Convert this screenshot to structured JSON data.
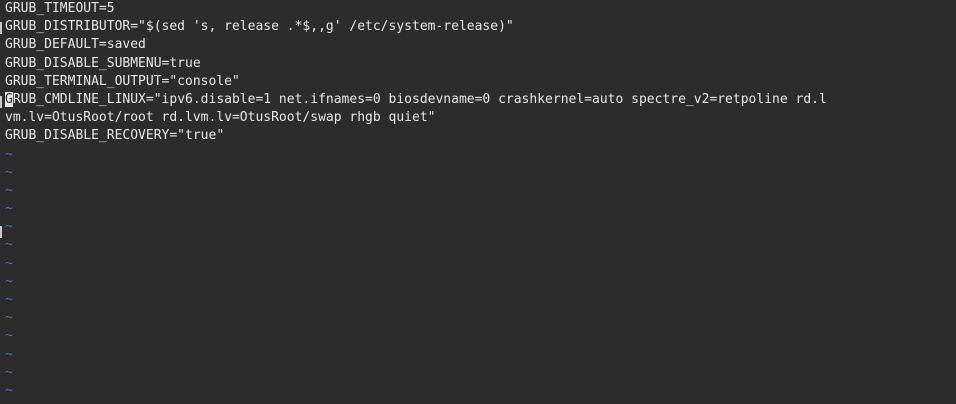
{
  "editor": {
    "lines": [
      "GRUB_TIMEOUT=5",
      "GRUB_DISTRIBUTOR=\"$(sed 's, release .*$,,g' /etc/system-release)\"",
      "GRUB_DEFAULT=saved",
      "GRUB_DISABLE_SUBMENU=true",
      "GRUB_TERMINAL_OUTPUT=\"console\"",
      "",
      "vm.lv=OtusRoot/root rd.lvm.lv=OtusRoot/swap rhgb quiet\"",
      "GRUB_DISABLE_RECOVERY=\"true\""
    ],
    "cursor_line": {
      "cursor_char": "G",
      "rest": "RUB_CMDLINE_LINUX=\"ipv6.disable=1 net.ifnames=0 biosdevname=0 crashkernel=auto spectre_v2=retpoline rd.l"
    },
    "empty_marker": "~"
  },
  "colors": {
    "background": "#2c2c2c",
    "text": "#e8e8e8",
    "tilde": "#4f6db8"
  }
}
